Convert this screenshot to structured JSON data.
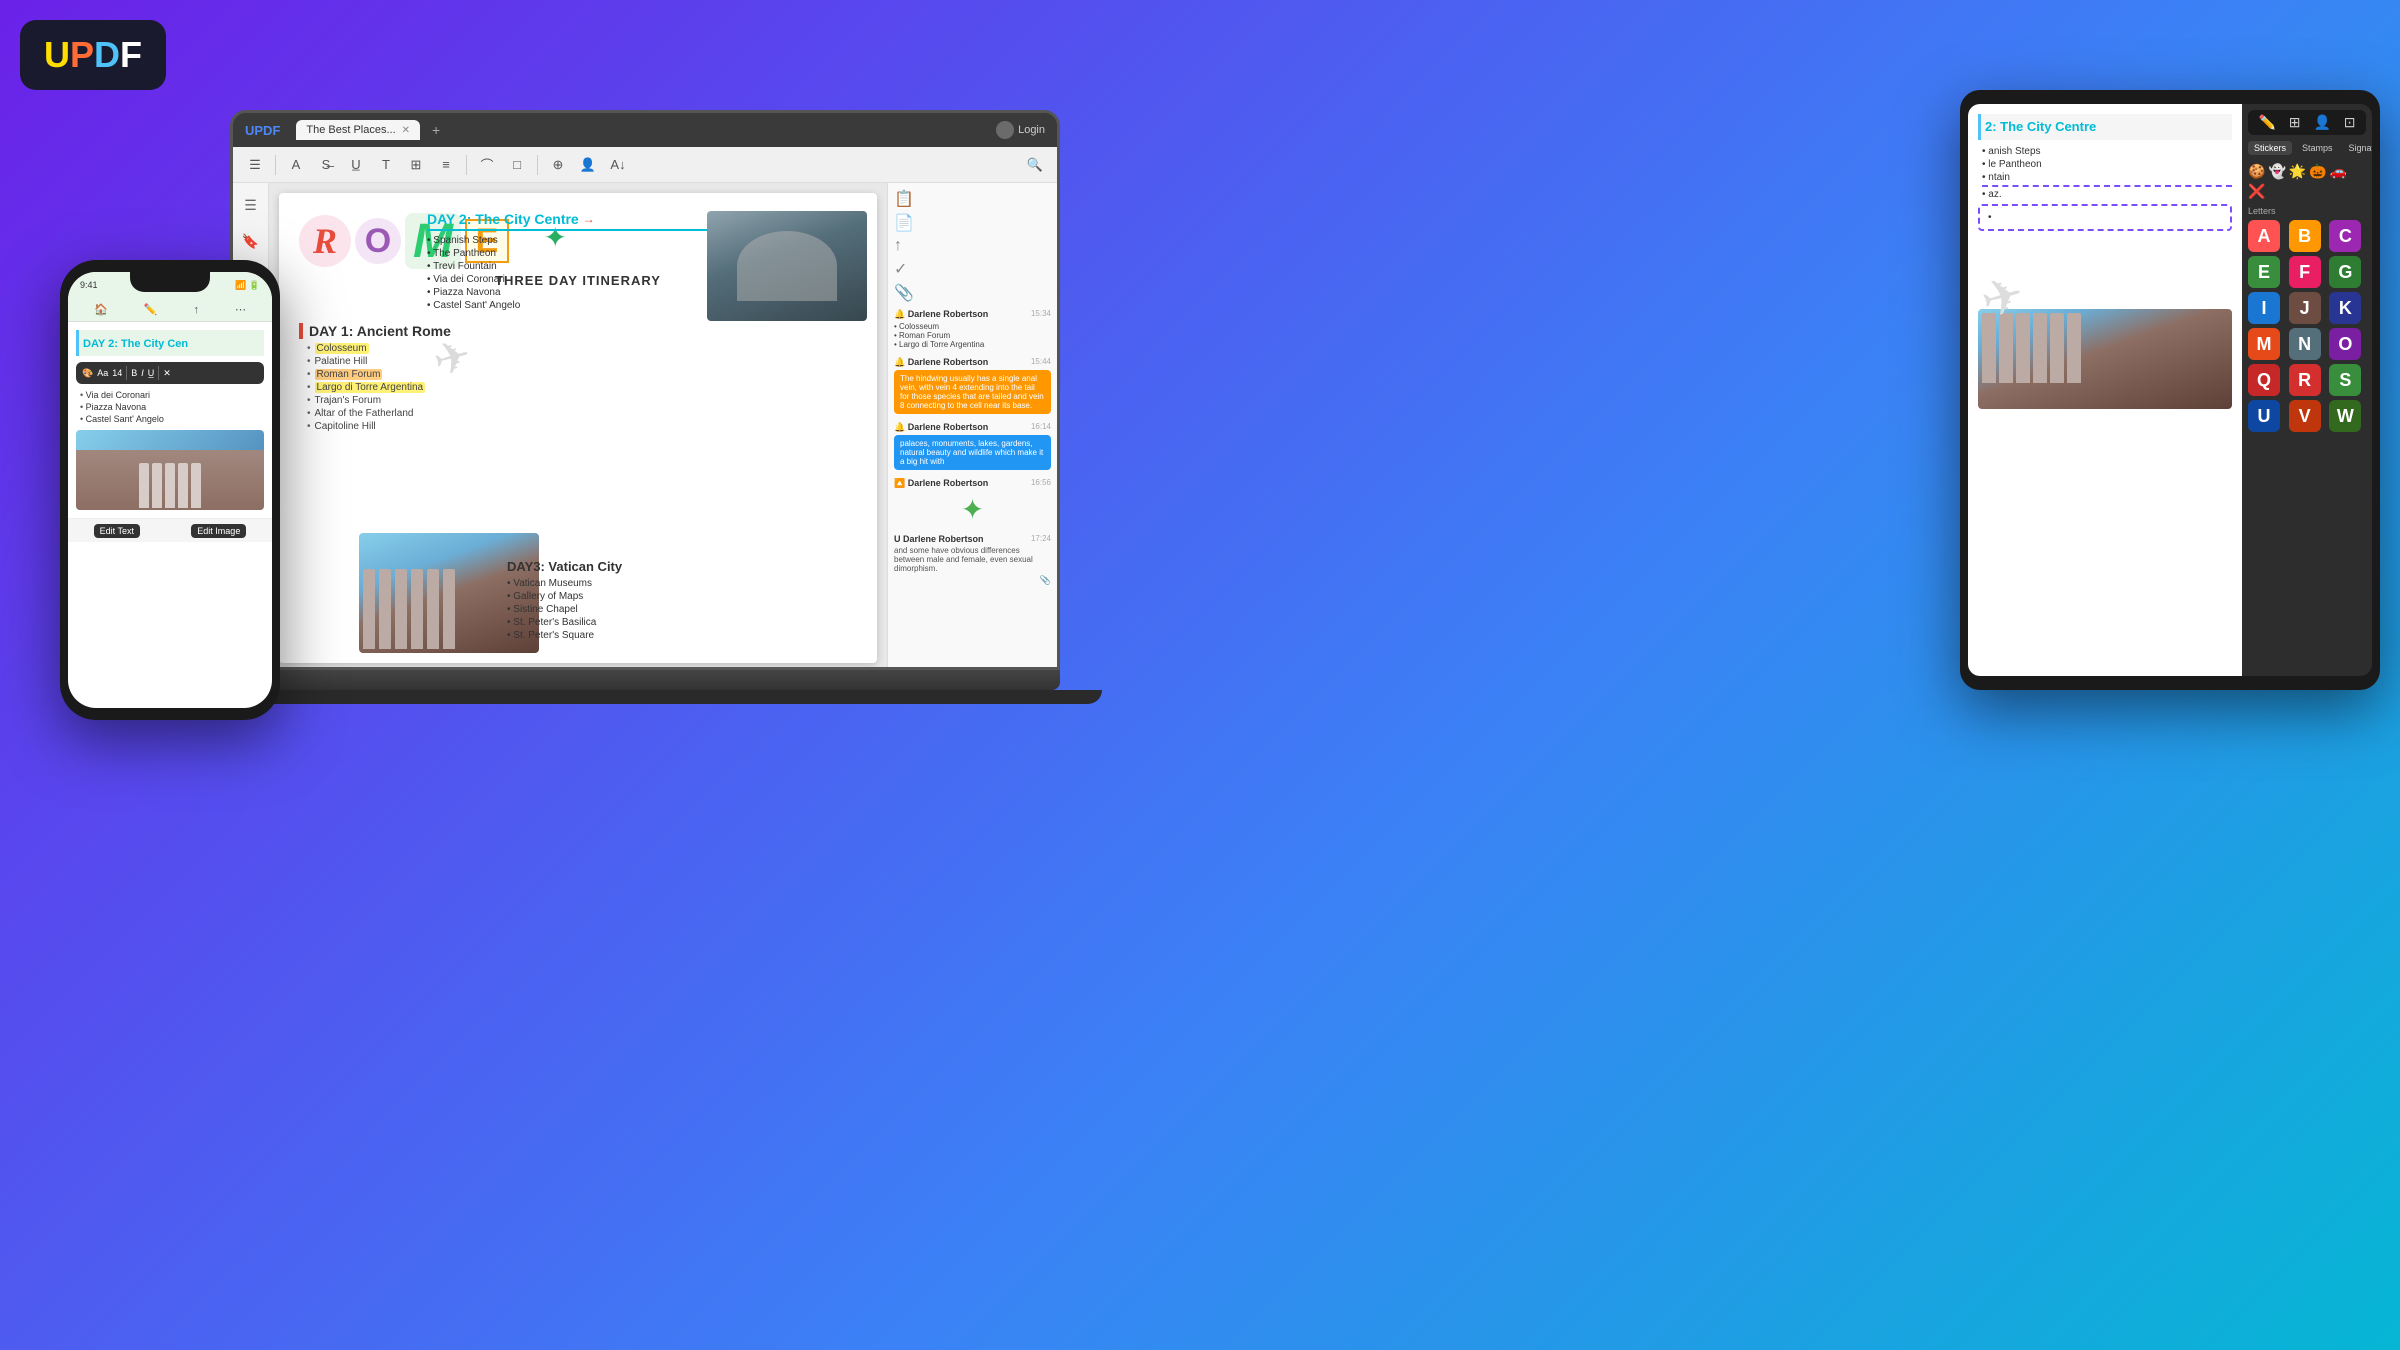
{
  "app": {
    "logo": "UPDF",
    "logo_letters": {
      "u": "U",
      "p": "P",
      "d": "D",
      "f": "F"
    }
  },
  "laptop": {
    "titlebar": {
      "brand": "UPDF",
      "tab_title": "The Best Places...",
      "login_label": "Login"
    },
    "toolbar_icons": [
      "☰",
      "A",
      "S̶",
      "U̲",
      "T",
      "T",
      "T̲",
      "T̲",
      "⌒",
      "□",
      "⊕",
      "👤",
      "A↓"
    ],
    "pdf": {
      "rome_letters": [
        "R",
        "O",
        "M",
        "E"
      ],
      "itinerary_label": "THREE DAY ITINERARY",
      "day1": {
        "title": "DAY 1: Ancient Rome",
        "places": [
          "Colosseum",
          "Palatine Hill",
          "Roman Forum",
          "Largo di Torre Argentina",
          "Trajan's Forum",
          "Altar of the Fatherland",
          "Capitoline Hill"
        ],
        "highlighted": [
          "Colosseum",
          "Roman Forum",
          "Largo di Torre Argentina"
        ]
      },
      "day2": {
        "title": "DAY 2: The City Centre",
        "places": [
          "Spanish Steps",
          "The Pantheon",
          "Trevi Fountain",
          "Via dei Coronari",
          "Piazza Navona",
          "Castel Sant' Angelo"
        ]
      },
      "day3": {
        "title": "DAY3: Vatican City",
        "places": [
          "Vatican Museums",
          "Gallery of Maps",
          "Sistine Chapel",
          "St. Peter's Basilica",
          "St. Peter's Square"
        ]
      }
    },
    "comments": [
      {
        "author": "Darlene Robertson",
        "time": "15:34",
        "bullets": [
          "Colosseum",
          "Roman Forum",
          "Largo di Torre Argentina"
        ]
      },
      {
        "author": "Darlene Robertson",
        "time": "15:44",
        "text": "The hindwing usually has a single anal vein, with vein 4 extending into the tail for those species that are tailed and vein 8 connecting to the cell near its base."
      },
      {
        "author": "Darlene Robertson",
        "time": "16:14",
        "text": "palaces, monuments, lakes, gardens, natural beauty and wildlife which make it a big hit with"
      },
      {
        "author": "Darlene Robertson",
        "time": "16:56",
        "star": true
      },
      {
        "author": "Darlene Robertson",
        "time": "17:24",
        "text": "and some have obvious differences between male and female, even sexual dimorphism."
      }
    ]
  },
  "phone": {
    "status_time": "9:41",
    "day2_title": "DAY 2: The City Cen",
    "places": [
      "Via dei Coronari",
      "Piazza Navona",
      "Castel Sant' Angelo"
    ],
    "bottom_buttons": [
      "Edit Text",
      "Edit Image"
    ]
  },
  "tablet": {
    "day2_title": "2: The City Centre",
    "places_partial": [
      "anish Steps",
      "le Pantheon",
      "ntain",
      "az.",
      ""
    ],
    "pantheon_label": "Pantheon",
    "stickers": {
      "tabs": [
        "Stickers",
        "Stamps",
        "Signature"
      ],
      "letters_label": "Letters",
      "letter_cells": [
        {
          "letter": "A",
          "bg": "#ff5252",
          "color": "#fff"
        },
        {
          "letter": "B",
          "bg": "#ff9800",
          "color": "#fff"
        },
        {
          "letter": "C",
          "bg": "#9c27b0",
          "color": "#fff"
        },
        {
          "letter": "E",
          "bg": "#4caf50",
          "color": "#fff"
        },
        {
          "letter": "F",
          "bg": "#e91e63",
          "color": "#fff"
        },
        {
          "letter": "G",
          "bg": "#43a047",
          "color": "#fff"
        },
        {
          "letter": "I",
          "bg": "#2196f3",
          "color": "#fff"
        },
        {
          "letter": "J",
          "bg": "#795548",
          "color": "#fff"
        },
        {
          "letter": "K",
          "bg": "#3f51b5",
          "color": "#fff"
        },
        {
          "letter": "M",
          "bg": "#ff5722",
          "color": "#fff"
        },
        {
          "letter": "N",
          "bg": "#607d8b",
          "color": "#fff"
        },
        {
          "letter": "O",
          "bg": "#9c27b0",
          "color": "#fff"
        },
        {
          "letter": "Q",
          "bg": "#e53935",
          "color": "#fff"
        },
        {
          "letter": "R",
          "bg": "#f44336",
          "color": "#fff"
        },
        {
          "letter": "S",
          "bg": "#4caf50",
          "color": "#fff"
        },
        {
          "letter": "U",
          "bg": "#1565c0",
          "color": "#fff"
        },
        {
          "letter": "V",
          "bg": "#bf360c",
          "color": "#fff"
        },
        {
          "letter": "W",
          "bg": "#33691e",
          "color": "#fff"
        }
      ]
    }
  }
}
